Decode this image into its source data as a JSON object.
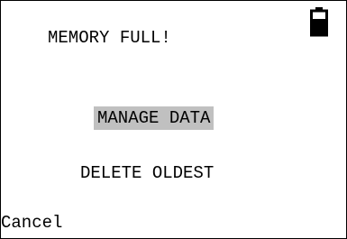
{
  "screen": {
    "title": "MEMORY FULL!",
    "battery_icon": "battery-icon",
    "menu": {
      "items": [
        {
          "label": "MANAGE DATA",
          "selected": true
        },
        {
          "label": "DELETE OLDEST",
          "selected": false
        }
      ]
    },
    "softkey_left": "Cancel",
    "colors": {
      "selection_highlight": "#c0c0c0",
      "text": "#000000",
      "background": "#ffffff"
    }
  }
}
